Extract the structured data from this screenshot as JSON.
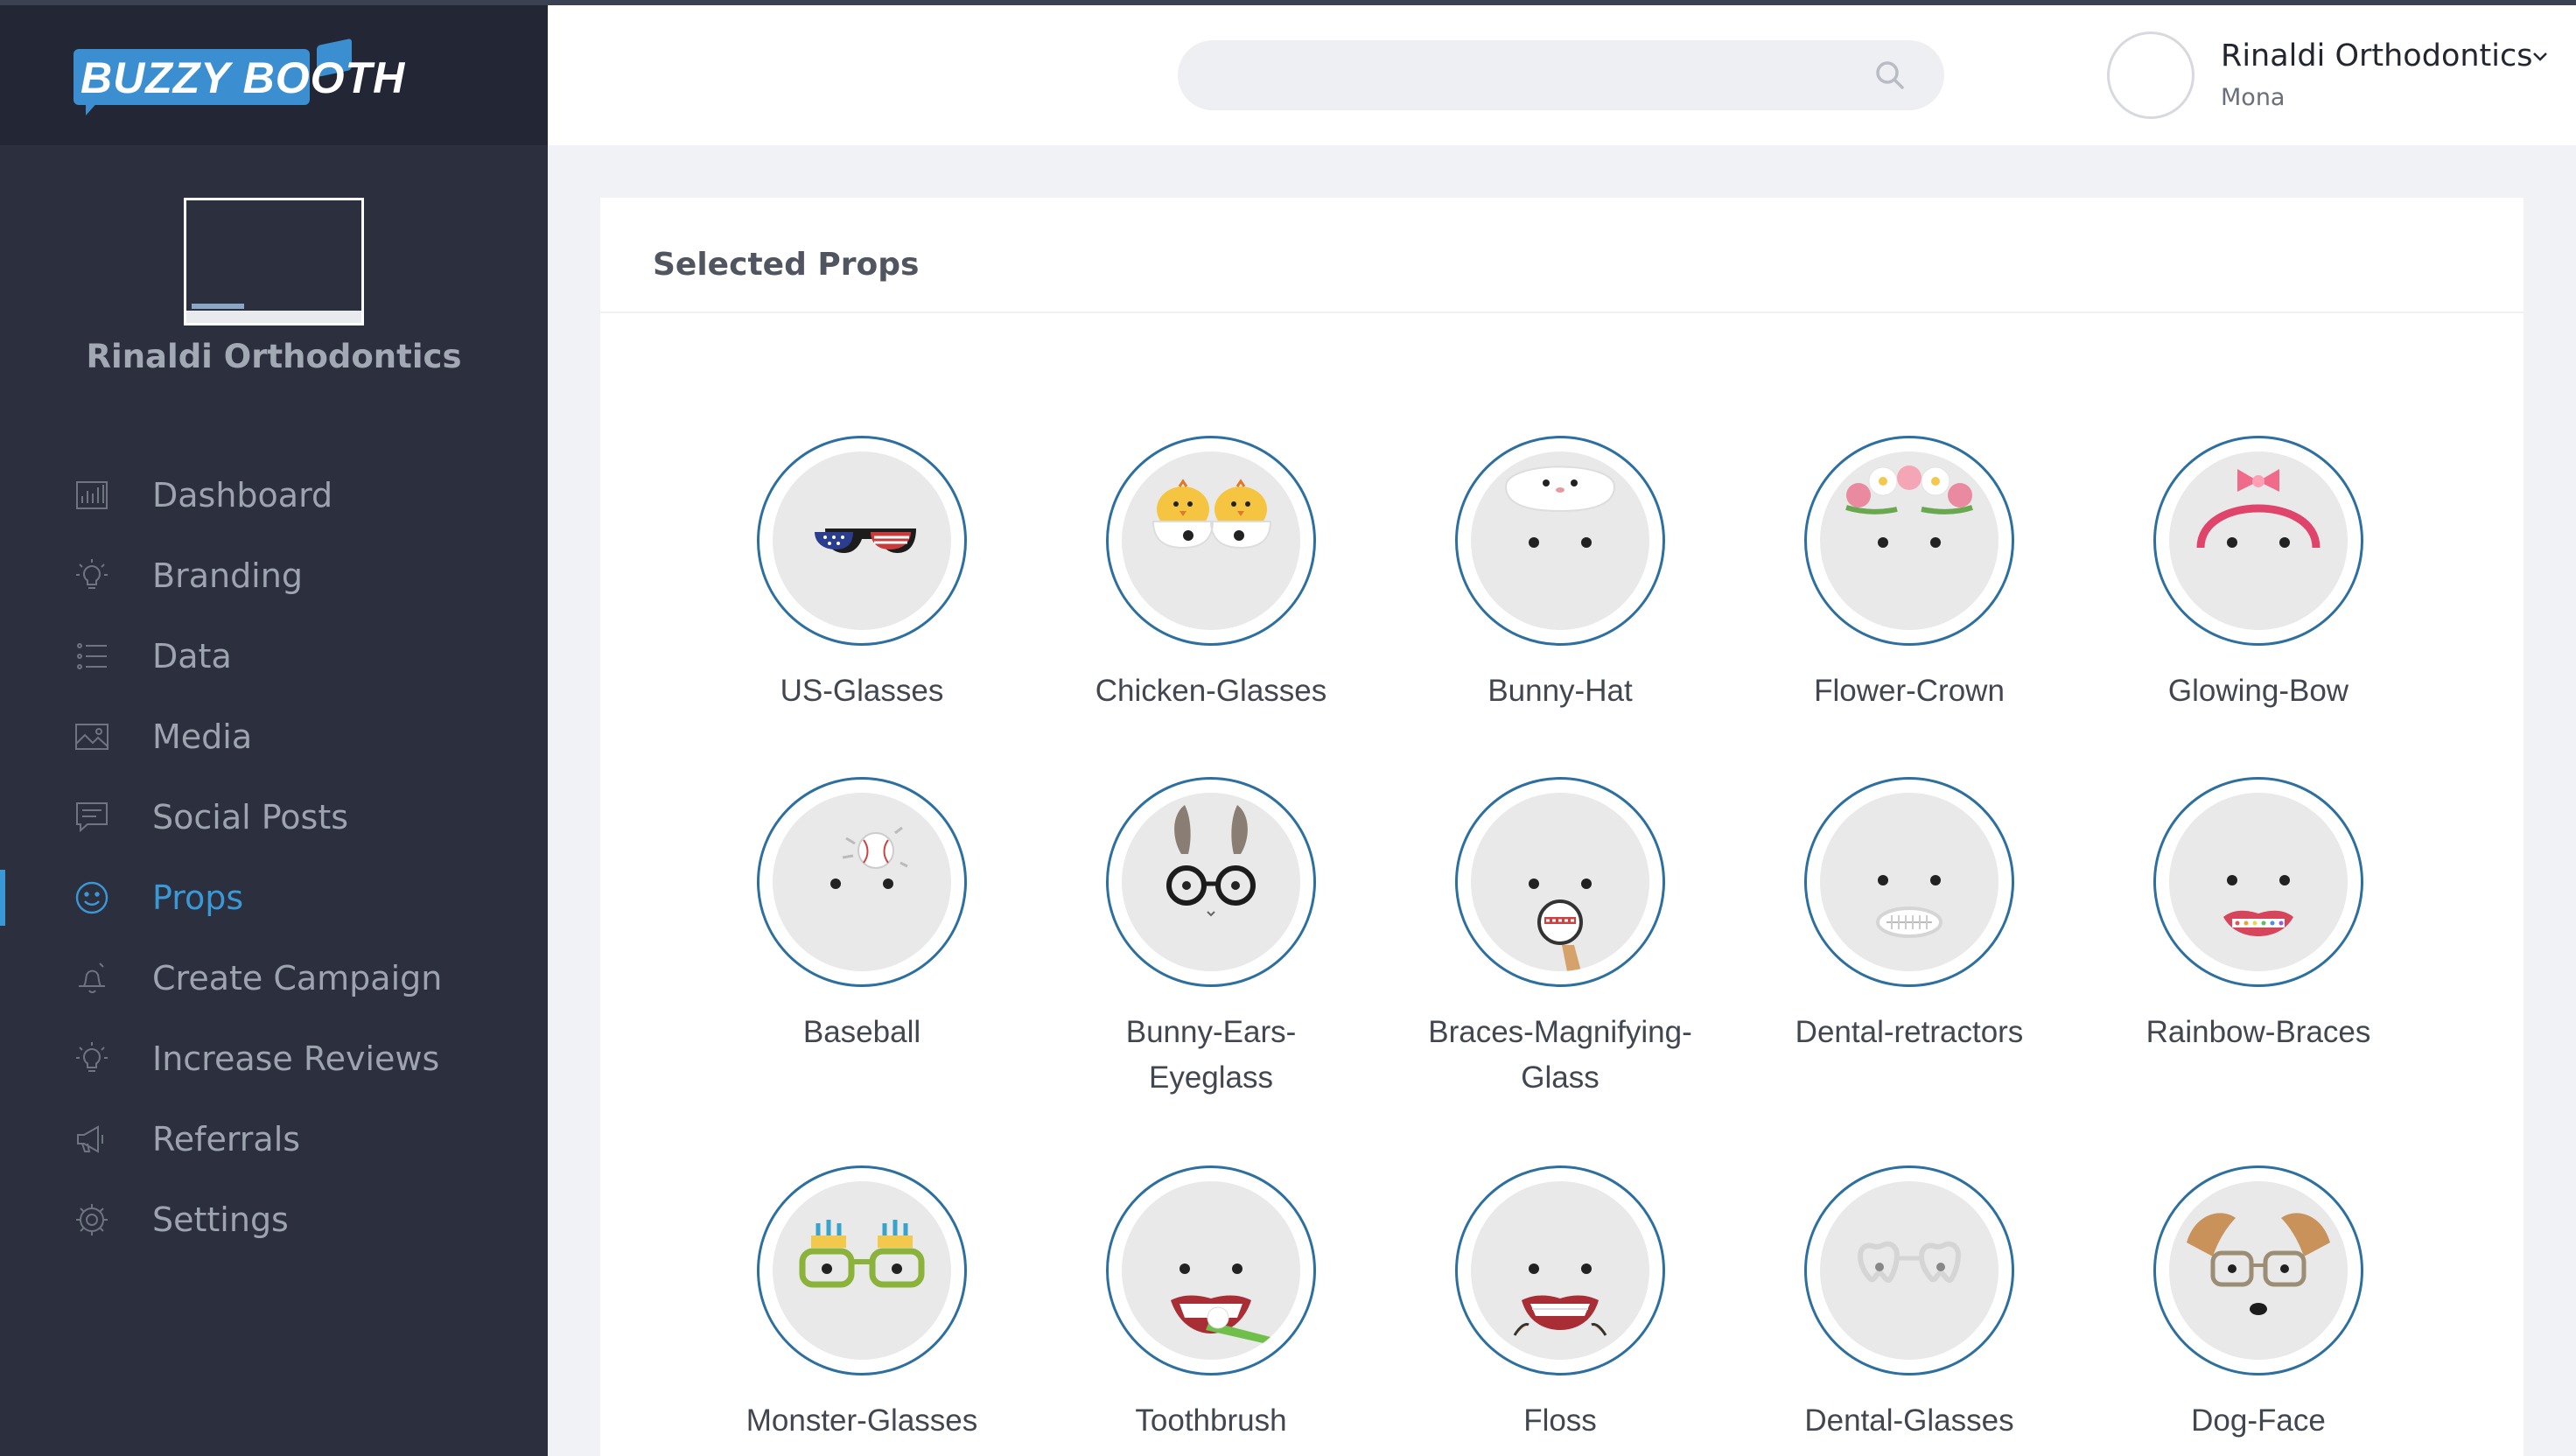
{
  "app": {
    "logo_text": "BUZZY BOOTH"
  },
  "sidebar": {
    "brand_name": "Rinaldi Orthodontics",
    "items": [
      {
        "label": "Dashboard",
        "icon": "chart-icon",
        "active": false
      },
      {
        "label": "Branding",
        "icon": "lightbulb-icon",
        "active": false
      },
      {
        "label": "Data",
        "icon": "list-icon",
        "active": false
      },
      {
        "label": "Media",
        "icon": "image-icon",
        "active": false
      },
      {
        "label": "Social Posts",
        "icon": "chat-icon",
        "active": false
      },
      {
        "label": "Props",
        "icon": "smiley-icon",
        "active": true
      },
      {
        "label": "Create Campaign",
        "icon": "bell-icon",
        "active": false
      },
      {
        "label": "Increase Reviews",
        "icon": "lightbulb-icon",
        "active": false
      },
      {
        "label": "Referrals",
        "icon": "megaphone-icon",
        "active": false
      },
      {
        "label": "Settings",
        "icon": "gear-icon",
        "active": false
      }
    ],
    "colors": {
      "background": "#2b2f3e",
      "active": "#3b98d6",
      "text": "#9ea3b0"
    }
  },
  "header": {
    "search_placeholder": "",
    "user": {
      "name": "Rinaldi Orthodontics",
      "sub": "Mona"
    }
  },
  "main": {
    "title": "Selected Props",
    "props": [
      {
        "label": "US-Glasses",
        "icon": "us-flag-glasses-icon"
      },
      {
        "label": "Chicken-Glasses",
        "icon": "chicken-glasses-icon"
      },
      {
        "label": "Bunny-Hat",
        "icon": "bunny-hat-icon"
      },
      {
        "label": "Flower-Crown",
        "icon": "flower-crown-icon"
      },
      {
        "label": "Glowing-Bow",
        "icon": "glowing-bow-icon"
      },
      {
        "label": "Baseball",
        "icon": "baseball-icon"
      },
      {
        "label": "Bunny-Ears-\nEyeglass",
        "icon": "bunny-ears-eyeglass-icon"
      },
      {
        "label": "Braces-Magnifying-\nGlass",
        "icon": "braces-magnifying-glass-icon"
      },
      {
        "label": "Dental-retractors",
        "icon": "dental-retractors-icon"
      },
      {
        "label": "Rainbow-Braces",
        "icon": "rainbow-braces-icon"
      },
      {
        "label": "Monster-Glasses",
        "icon": "monster-glasses-icon"
      },
      {
        "label": "Toothbrush",
        "icon": "toothbrush-icon"
      },
      {
        "label": "Floss",
        "icon": "floss-icon"
      },
      {
        "label": "Dental-Glasses",
        "icon": "dental-glasses-icon"
      },
      {
        "label": "Dog-Face",
        "icon": "dog-face-icon"
      }
    ],
    "colors": {
      "circle_border": "#2d6f9f",
      "circle_fill": "#e9e9ea"
    }
  }
}
